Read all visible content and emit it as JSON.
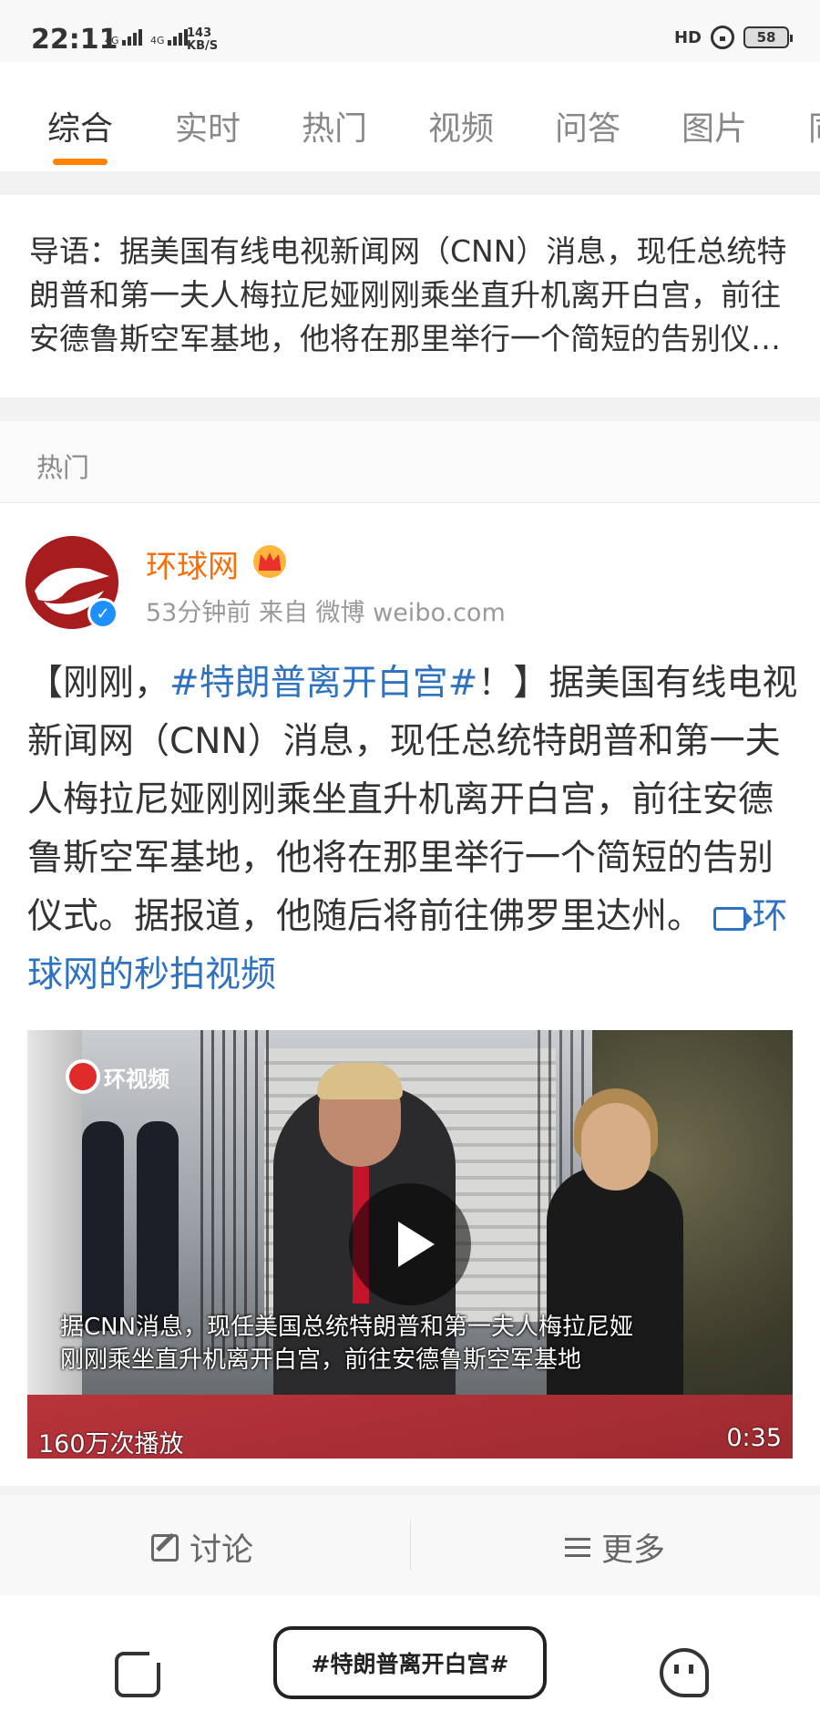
{
  "status_bar": {
    "time": "22:11",
    "signal1_label": "4G",
    "signal2_label": "4G",
    "net_speed_value": "143",
    "net_speed_unit": "KB/S",
    "hd_label": "HD",
    "battery_level": "58"
  },
  "tabs": [
    {
      "label": "综合",
      "active": true
    },
    {
      "label": "实时",
      "active": false
    },
    {
      "label": "热门",
      "active": false
    },
    {
      "label": "视频",
      "active": false
    },
    {
      "label": "问答",
      "active": false
    },
    {
      "label": "图片",
      "active": false
    },
    {
      "label": "同",
      "active": false
    }
  ],
  "intro": {
    "text": "导语：据美国有线电视新闻网（CNN）消息，现任总统特朗普和第一夫人梅拉尼娅刚刚乘坐直升机离开白宫，前往安德鲁斯空军基地，他将在那里举行一个简短的告别仪式。"
  },
  "section": {
    "label": "热门"
  },
  "post": {
    "author": "环球网",
    "time": "53分钟前",
    "source": "来自 微博 weibo.com",
    "body_prefix": "【刚刚，",
    "body_topic": "#特朗普离开白宫#",
    "body_main": "！】据美国有线电视新闻网（CNN）消息，现任总统特朗普和第一夫人梅拉尼娅刚刚乘坐直升机离开白宫，前往安德鲁斯空军基地，他将在那里举行一个简短的告别仪式。据报道，他随后将前往佛罗里达州。",
    "video_link": "环球网的秒拍视频",
    "video": {
      "watermark": "环视频",
      "subtitle_line1": "据CNN消息，现任美国总统特朗普和第一夫人梅拉尼娅",
      "subtitle_line2": "刚刚乘坐直升机离开白宫，前往安德鲁斯空军基地",
      "play_count": "160万次播放",
      "duration": "0:35"
    }
  },
  "actions": {
    "discuss": "讨论",
    "more": "更多"
  },
  "bottom_nav": {
    "topic_pill": "#特朗普离开白宫#"
  },
  "colors": {
    "accent": "#ff8200",
    "author": "#f86e0b",
    "link": "#2f73c0"
  }
}
